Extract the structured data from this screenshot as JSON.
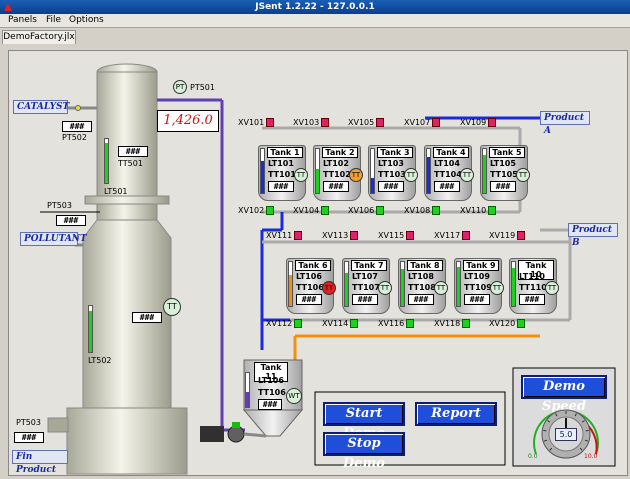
{
  "window": {
    "title": "JSent 1.2.22 - 127.0.0.1"
  },
  "menu": {
    "items": [
      "Panels",
      "File",
      "Options"
    ]
  },
  "tabs": [
    {
      "label": "DemoFactory.jlx"
    }
  ],
  "column": {
    "catalyst": "CATALYST",
    "pollutant": "POLLUTANT",
    "fin_product": "Fin Product",
    "pt501": "PT501",
    "pt501_value": "1,426.0",
    "pt502": "PT502",
    "pt503_top": "PT503",
    "pt503_bottom": "PT503",
    "tt501": "TT501",
    "lt501": "LT501",
    "lt502": "LT502",
    "placeholder": "###",
    "pt_badge": "PT",
    "tt_badge": "TT"
  },
  "product_a": "Product A",
  "product_b": "Product B",
  "tanks_row1": [
    {
      "name": "Tank 1",
      "lt": "LT101",
      "tt": "TT101",
      "level": 0.72,
      "color": "#1a2adf",
      "valve_in": "XV101",
      "valve_out": "XV102"
    },
    {
      "name": "Tank 2",
      "lt": "LT102",
      "tt": "TT102",
      "level": 0.55,
      "color": "#1fd01f",
      "valve_in": "XV103",
      "valve_out": "XV104"
    },
    {
      "name": "Tank 3",
      "lt": "LT103",
      "tt": "TT103",
      "level": 0.35,
      "color": "#1a2adf",
      "valve_in": "XV105",
      "valve_out": "XV106"
    },
    {
      "name": "Tank 4",
      "lt": "LT104",
      "tt": "TT104",
      "level": 0.82,
      "color": "#1a2adf",
      "valve_in": "XV107",
      "valve_out": "XV108"
    },
    {
      "name": "Tank 5",
      "lt": "LT105",
      "tt": "TT105",
      "level": 0.86,
      "color": "#1fd01f",
      "valve_in": "XV109",
      "valve_out": "XV110"
    }
  ],
  "tanks_row2": [
    {
      "name": "Tank 6",
      "lt": "LT106",
      "tt": "TT106",
      "level": 0.7,
      "color": "#f09010",
      "valve_in": "XV111",
      "valve_out": "XV112"
    },
    {
      "name": "Tank 7",
      "lt": "LT107",
      "tt": "TT107",
      "level": 0.74,
      "color": "#1fd01f",
      "valve_in": "XV113",
      "valve_out": "XV114"
    },
    {
      "name": "Tank 8",
      "lt": "LT108",
      "tt": "TT108",
      "level": 0.84,
      "color": "#1fd01f",
      "valve_in": "XV115",
      "valve_out": "XV116"
    },
    {
      "name": "Tank 9",
      "lt": "LT109",
      "tt": "TT109",
      "level": 0.88,
      "color": "#1fd01f",
      "valve_in": "XV117",
      "valve_out": "XV118"
    },
    {
      "name": "Tank 10",
      "lt": "LT110",
      "tt": "TT110",
      "level": 0.86,
      "color": "#1fd01f",
      "valve_in": "XV119",
      "valve_out": "XV120"
    }
  ],
  "tank11": {
    "name": "Tank 11",
    "lt": "LT106",
    "tt": "TT106",
    "wt": "WT",
    "level": 0.45
  },
  "controls": {
    "start": "Start Demo",
    "report": "Report",
    "stop": "Stop Demo",
    "demo_speed": "Demo Speed",
    "speed_value": "5.0",
    "speed_min": "0.0",
    "speed_max": "10.0",
    "speed_fraction": 0.5
  }
}
